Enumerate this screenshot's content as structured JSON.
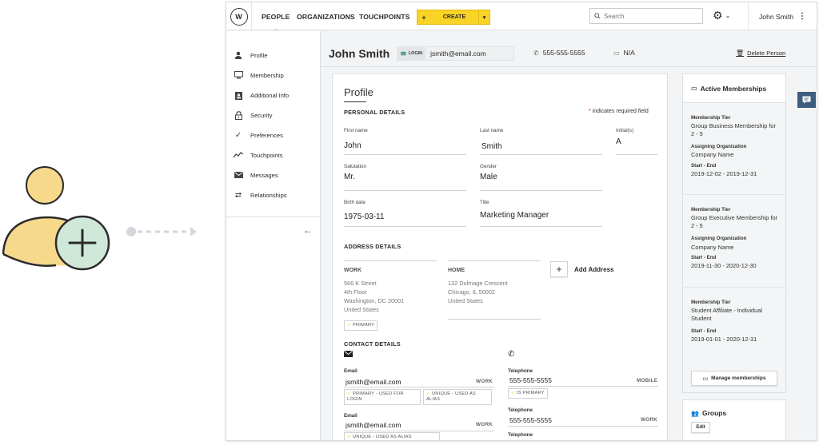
{
  "topnav": {
    "items": [
      "PEOPLE",
      "ORGANIZATIONS",
      "TOUCHPOINTS"
    ],
    "create_label": "CREATE",
    "create_plus": "+",
    "search_placeholder": "Search",
    "user_name": "John Smith"
  },
  "sidebar": {
    "items": [
      {
        "label": "Profile",
        "icon": "person-icon"
      },
      {
        "label": "Membership",
        "icon": "monitor-icon"
      },
      {
        "label": "Additional Info",
        "icon": "id-badge-icon"
      },
      {
        "label": "Security",
        "icon": "lock-icon"
      },
      {
        "label": "Preferences",
        "icon": "check-icon"
      },
      {
        "label": "Touchpoints",
        "icon": "activity-icon"
      },
      {
        "label": "Messages",
        "icon": "envelope-icon"
      },
      {
        "label": "Relationships",
        "icon": "swap-icon"
      }
    ]
  },
  "header": {
    "name": "John Smith",
    "login_badge": "LOGIN",
    "login_email": "jsmith@email.com",
    "phone": "555-555-5555",
    "device": "N/A",
    "delete_label": "Delete Person"
  },
  "profile": {
    "title": "Profile",
    "personal_title": "PERSONAL DETAILS",
    "required_note": "indicates required field",
    "required_star": "*",
    "fields": {
      "first_name": {
        "label": "First name",
        "value": "John"
      },
      "last_name": {
        "label": "Last name",
        "value": "Smith"
      },
      "initials": {
        "label": "Initial(s)",
        "value": "A"
      },
      "salutation": {
        "label": "Salutation",
        "value": "Mr."
      },
      "gender": {
        "label": "Gender",
        "value": "Male"
      },
      "birth_date": {
        "label": "Birth date",
        "value": "1975-03-11"
      },
      "title": {
        "label": "Title",
        "value": "Marketing Manager"
      }
    },
    "address_title": "ADDRESS DETAILS",
    "addresses": [
      {
        "type": "WORK",
        "lines": [
          "566 K Street",
          "4th Floor",
          "Washington, DC 20001",
          "United States"
        ],
        "chip": "PRIMARY"
      },
      {
        "type": "HOME",
        "lines": [
          "132 Dulmage Crescent",
          "Chicago, IL 50002",
          "United States"
        ]
      }
    ],
    "add_address": "Add Address",
    "add_address_plus": "+",
    "contact_title": "CONTACT DETAILS",
    "emails": [
      {
        "label": "Email",
        "value": "jsmith@email.com",
        "type": "WORK",
        "chips": [
          "PRIMARY - USED FOR LOGIN",
          "UNIQUE - USED AS ALIAS"
        ]
      },
      {
        "label": "Email",
        "value": "jsmith@email.com",
        "type": "WORK",
        "chips": [
          "UNIQUE - USED AS ALIAS"
        ]
      }
    ],
    "phones": [
      {
        "label": "Telephone",
        "value": "555-555-5555",
        "type": "MOBILE",
        "chips": [
          "IS PRIMARY"
        ]
      },
      {
        "label": "Telephone",
        "value": "555-555-5555",
        "type": "WORK"
      },
      {
        "label": "Telephone"
      }
    ]
  },
  "memberships": {
    "title": "Active Memberships",
    "tier_label": "Membership Tier",
    "org_label": "Assigning Organization",
    "dates_label": "Start - End",
    "items": [
      {
        "tier": "Group Business Membership for 2 - 5",
        "org": "Company Name",
        "dates": "2019-12-02 - 2019-12-31"
      },
      {
        "tier": "Group Executive Membership for 2 - 5",
        "org": "Company Name",
        "dates": "2019-11-30 - 2020-12-30"
      },
      {
        "tier": "Student Affiliate - Individual Student",
        "dates": "2019-01-01 - 2020-12-31"
      }
    ],
    "manage_label": "Manage memberships"
  },
  "groups": {
    "title": "Groups",
    "edit_label": "Edit"
  },
  "colors": {
    "create_yellow": "#f9d326",
    "illustration_yellow": "#f7d98b",
    "illustration_green": "#cfe8da",
    "chat_blue": "#3e5d7f"
  }
}
